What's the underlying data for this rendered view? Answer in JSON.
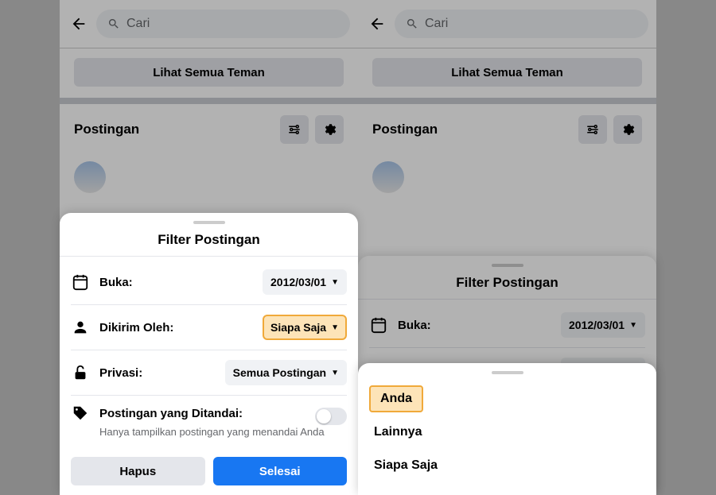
{
  "search": {
    "placeholder": "Cari"
  },
  "friends_button": "Lihat Semua Teman",
  "posts_section": {
    "title": "Postingan"
  },
  "sheet": {
    "title": "Filter Postingan",
    "open": {
      "label": "Buka:",
      "value": "2012/03/01"
    },
    "posted_by": {
      "label": "Dikirim Oleh:",
      "value": "Siapa Saja"
    },
    "privacy": {
      "label": "Privasi:",
      "value": "Semua Postingan"
    },
    "tagged": {
      "label": "Postingan yang Ditandai:",
      "sub": "Hanya tampilkan postingan yang menandai Anda"
    },
    "clear": "Hapus",
    "done": "Selesai"
  },
  "options": {
    "you": "Anda",
    "others": "Lainnya",
    "anyone": "Siapa Saja"
  }
}
